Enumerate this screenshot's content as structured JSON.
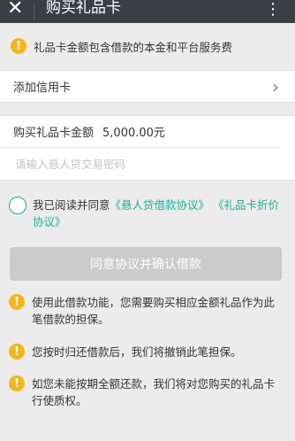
{
  "header": {
    "close": "✕",
    "title": "购买礼品卡",
    "more": "⋮"
  },
  "notice": {
    "icon": "warning-icon",
    "text": "礼品卡金额包含借款的本金和平台服务费"
  },
  "credit_card": {
    "label": "添加信用卡",
    "chevron": "›"
  },
  "form": {
    "amount_label": "购买礼品卡金额",
    "amount_value": "5,000.00元",
    "password_placeholder": "请输入悬人贷交易密码"
  },
  "agreement": {
    "prefix": "我已阅读并同意",
    "link1": "《悬人贷借款协议》",
    "link2": "《礼品卡折价协议》"
  },
  "confirm_button": "同意协议并确认借款",
  "tips": [
    "使用此借款功能，您需要购买相应金额礼品作为此笔借款的担保。",
    "您按时归还借款后，我们将撤销此笔担保。",
    "如您未能按期全额还款，我们将对您购买的礼品卡行使质权。"
  ],
  "colors": {
    "accent": "#1aad9b",
    "warning": "#f5b51f",
    "titlebar": "#3a3f45",
    "disabled_button": "#cbcbcb"
  }
}
